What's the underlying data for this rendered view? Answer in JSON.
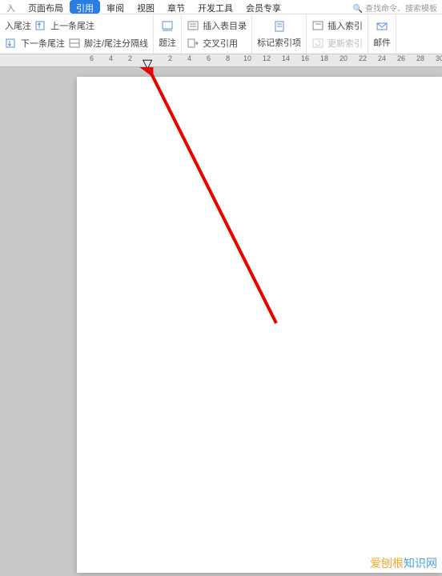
{
  "menubar": {
    "tabs_partial_left": "入",
    "tabs": [
      "页面布局",
      "引用",
      "审阅",
      "视图",
      "章节",
      "开发工具",
      "会员专享"
    ],
    "active_index": 1,
    "search_hint": "查找命令、搜索模板"
  },
  "ribbon": {
    "group1": {
      "item_top": "入尾注",
      "item_prev": "上一条尾注",
      "item_next": "下一条尾注",
      "item_sep": "脚注/尾注分隔线"
    },
    "group2": {
      "caption": "题注"
    },
    "group3": {
      "insert_table": "插入表目录",
      "cross_ref": "交叉引用"
    },
    "group4": {
      "mark_index": "标记索引项"
    },
    "group5": {
      "insert_index": "插入索引",
      "update_index": "更新索引"
    },
    "group6": {
      "mail": "邮件"
    }
  },
  "ruler": {
    "left_values": [
      "6",
      "4",
      "2"
    ],
    "right_values": [
      "2",
      "4",
      "6",
      "8",
      "10",
      "12",
      "14",
      "16",
      "18",
      "20",
      "22",
      "24",
      "26",
      "28",
      "30"
    ],
    "indent_marker": "▽"
  },
  "annotation": {
    "arrow_color": "#e60000"
  },
  "watermark": {
    "text_main": "爱刨根",
    "text_blue": "知识网"
  }
}
